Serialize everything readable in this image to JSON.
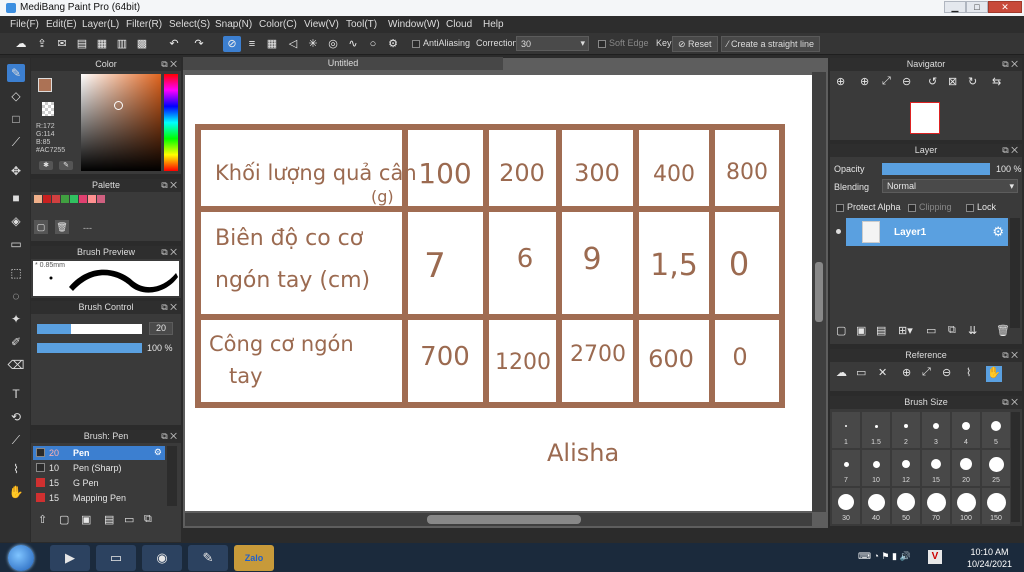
{
  "window": {
    "title": "MediBang Paint Pro (64bit)",
    "min": "▁",
    "max": "□",
    "close": "✕"
  },
  "menu": [
    "File(F)",
    "Edit(E)",
    "Layer(L)",
    "Filter(R)",
    "Select(S)",
    "Snap(N)",
    "Color(C)",
    "View(V)",
    "Tool(T)",
    "Window(W)",
    "Cloud",
    "Help"
  ],
  "toolbar": {
    "antialiasing_label": "AntiAliasing",
    "correction_label": "Correction",
    "correction_value": "30",
    "soft_edge_label": "Soft Edge",
    "key_label": "Key",
    "reset_label": "Reset",
    "straight_line_label": "Create a straight line"
  },
  "color_panel": {
    "title": "Color",
    "r": "R:172",
    "g": "G:114",
    "b": "B:85",
    "hex": "#AC7255",
    "primary": "#AC7255"
  },
  "palette_panel": {
    "title": "Palette",
    "swatches": [
      "#f0b08a",
      "#c82020",
      "#d04040",
      "#40a040",
      "#30c060",
      "#e04070",
      "#ff9090",
      "#d06080"
    ],
    "more": "---"
  },
  "brush_preview": {
    "title": "Brush Preview",
    "size": "* 0.85mm"
  },
  "brush_control": {
    "title": "Brush Control",
    "size_value": "20",
    "opacity_value": "100 %",
    "size_level": 0.32,
    "opacity_level": 1.0
  },
  "brush_list": {
    "title": "Brush: Pen",
    "items": [
      {
        "size": "20",
        "name": "Pen",
        "color": "#2a2a2a",
        "selected": true
      },
      {
        "size": "10",
        "name": "Pen (Sharp)",
        "color": "#2a2a2a",
        "selected": false
      },
      {
        "size": "15",
        "name": "G Pen",
        "color": "#d03030",
        "selected": false
      },
      {
        "size": "15",
        "name": "Mapping Pen",
        "color": "#d03030",
        "selected": false
      }
    ]
  },
  "document": {
    "tab": "Untitled"
  },
  "drawing": {
    "rows": [
      {
        "label_lines": [
          "Khối lượng quả cân",
          "(g)"
        ],
        "cells": [
          "100",
          "200",
          "300",
          "400",
          "800"
        ]
      },
      {
        "label_lines": [
          "Biên độ co cơ",
          "ngón tay (cm)"
        ],
        "cells": [
          "7",
          "6",
          "9",
          "1,5",
          "0"
        ]
      },
      {
        "label_lines": [
          "Công cơ ngón",
          "tay"
        ],
        "cells": [
          "700",
          "1200",
          "2700",
          "600",
          "0"
        ]
      }
    ],
    "signature": "Alisha"
  },
  "navigator": {
    "title": "Navigator"
  },
  "layer_panel": {
    "title": "Layer",
    "opacity_label": "Opacity",
    "opacity_value": "100 %",
    "blending_label": "Blending",
    "blending_value": "Normal",
    "protect_alpha": "Protect Alpha",
    "clipping": "Clipping",
    "lock": "Lock",
    "layer_name": "Layer1"
  },
  "reference_panel": {
    "title": "Reference"
  },
  "brush_size_panel": {
    "title": "Brush Size",
    "sizes": [
      "1",
      "1.5",
      "2",
      "3",
      "4",
      "5",
      "7",
      "10",
      "12",
      "15",
      "20",
      "25",
      "30",
      "40",
      "50",
      "70",
      "100",
      "150"
    ]
  },
  "taskbar": {
    "time": "10:10 AM",
    "date": "10/24/2021",
    "zalo": "Zalo"
  }
}
